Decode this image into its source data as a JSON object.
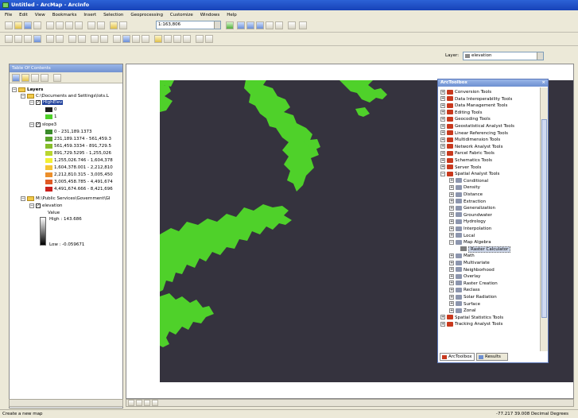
{
  "window": {
    "title": "Untitled - ArcMap - ArcInfo"
  },
  "menu": [
    "File",
    "Edit",
    "View",
    "Bookmarks",
    "Insert",
    "Selection",
    "Geoprocessing",
    "Customize",
    "Windows",
    "Help"
  ],
  "toolbar": {
    "scale": "1:163,806"
  },
  "layer_selector": {
    "label": "Layer:",
    "value": "elevation"
  },
  "toc": {
    "title": "Table Of Contents",
    "root": "Layers",
    "group1": "C:\\Documents and Settings\\lots.L",
    "highelev": {
      "name": "HighElev",
      "classes": [
        "0",
        "1"
      ]
    },
    "slope": {
      "name": "slope3",
      "classes": [
        {
          "label": "0 - 231,189.1373",
          "color": "#3a8a2a"
        },
        {
          "label": "231,189.1374 - 561,459.3",
          "color": "#5aa32a"
        },
        {
          "label": "561,459.3334 - 891,729.5",
          "color": "#86bd2a"
        },
        {
          "label": "891,729.5295 - 1,255,026",
          "color": "#b9d52f"
        },
        {
          "label": "1,255,026.746 - 1,604,378",
          "color": "#f2f034"
        },
        {
          "label": "1,604,378.001 - 2,212,810",
          "color": "#f5c431"
        },
        {
          "label": "2,212,810.315 - 3,005,450",
          "color": "#ec8f2b"
        },
        {
          "label": "3,005,458.785 - 4,491,674",
          "color": "#e05a24"
        },
        {
          "label": "4,491,674.666 - 8,421,696",
          "color": "#c9211d"
        }
      ]
    },
    "group2": "M:\\Public Services\\Government\\GI",
    "elevation": {
      "name": "elevation",
      "value_label": "Value",
      "high": "High : 143.686",
      "low": "Low : -0.059671"
    }
  },
  "toolbox": {
    "title": "ArcToolbox",
    "toolboxes": [
      "Conversion Tools",
      "Data Interoperability Tools",
      "Data Management Tools",
      "Editing Tools",
      "Geocoding Tools",
      "Geostatistical Analyst Tools",
      "Linear Referencing Tools",
      "Multidimension Tools",
      "Network Analyst Tools",
      "Parcel Fabric Tools",
      "Schematics Tools",
      "Server Tools",
      "Spatial Analyst Tools"
    ],
    "spatial_sets_before": [
      "Conditional",
      "Density",
      "Distance",
      "Extraction",
      "Generalization",
      "Groundwater",
      "Hydrology",
      "Interpolation",
      "Local",
      "Map Algebra"
    ],
    "selected_tool": "Raster Calculator",
    "spatial_sets_after": [
      "Math",
      "Multivariate",
      "Neighborhood",
      "Overlay",
      "Raster Creation",
      "Reclass",
      "Solar Radiation",
      "Surface",
      "Zonal"
    ],
    "after_list": [
      "Spatial Statistics Tools",
      "Tracking Analyst Tools"
    ],
    "tabs": [
      "ArcToolbox",
      "Results"
    ]
  },
  "status": {
    "left": "Create a new map",
    "coords": "-77.217  39.008 Decimal Degrees"
  },
  "colors": {
    "map_bg": "#35333e",
    "high_elev": "#4fd12a",
    "title": "#2c62d6"
  }
}
